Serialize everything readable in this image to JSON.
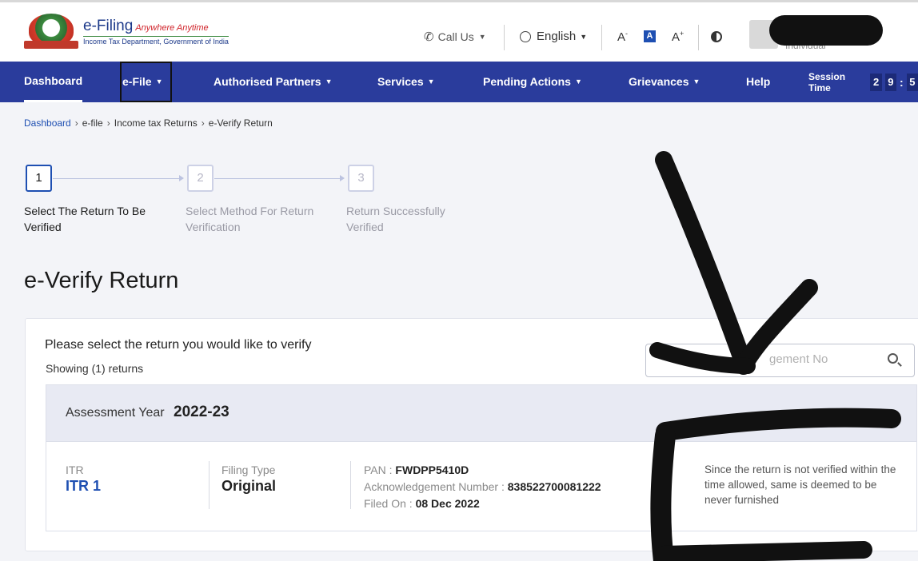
{
  "header": {
    "logo_title": "e-Filing",
    "logo_tagline": "Anywhere Anytime",
    "logo_subtitle": "Income Tax Department, Government of India",
    "call_us": "Call Us",
    "language": "English",
    "font_decrease": "A",
    "font_normal": "A",
    "font_increase": "A",
    "user_role": "Individual"
  },
  "nav": {
    "items": [
      {
        "label": "Dashboard"
      },
      {
        "label": "e-File"
      },
      {
        "label": "Authorised Partners"
      },
      {
        "label": "Services"
      },
      {
        "label": "Pending Actions"
      },
      {
        "label": "Grievances"
      },
      {
        "label": "Help"
      }
    ],
    "session_label": "Session Time",
    "session_digits": [
      "2",
      "9",
      "5"
    ]
  },
  "breadcrumb": [
    "Dashboard",
    "e-file",
    "Income tax Returns",
    "e-Verify Return"
  ],
  "stepper": [
    {
      "number": "1",
      "label": "Select The Return To Be Verified"
    },
    {
      "number": "2",
      "label": "Select Method For Return Verification"
    },
    {
      "number": "3",
      "label": "Return Successfully Verified"
    }
  ],
  "page_title": "e-Verify Return",
  "card": {
    "heading": "Please select the return you would like to verify",
    "count": "Showing (1) returns",
    "search_placeholder": "gement No"
  },
  "return": {
    "ay_label": "Assessment Year",
    "ay_value": "2022-23",
    "itr_label": "ITR",
    "itr_value": "ITR 1",
    "filing_type_label": "Filing Type",
    "filing_type_value": "Original",
    "pan_label": "PAN : ",
    "pan_value": "FWDPP5410D",
    "ack_label": "Acknowledgement Number : ",
    "ack_value": "838522700081222",
    "filed_label": "Filed On : ",
    "filed_value": "08 Dec 2022",
    "notice": "Since the return is not verified within the time allowed, same is deemed to be never furnished"
  },
  "colors": {
    "nav_bg": "#2a3c9c",
    "accent": "#1e4fb2",
    "page_bg": "#f3f4f8",
    "redaction": "#111111"
  }
}
